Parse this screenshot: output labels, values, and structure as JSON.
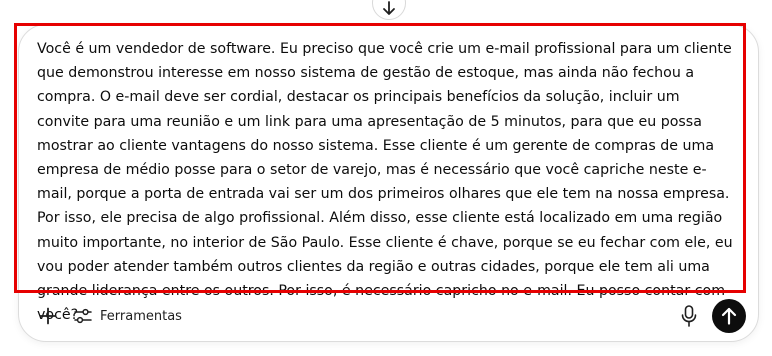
{
  "composer": {
    "prompt_text": "Você é um vendedor de software. Eu preciso que você crie um e-mail profissional para um cliente que demonstrou interesse em nosso sistema de gestão de estoque, mas ainda não fechou a compra. O e-mail deve ser cordial, destacar os principais benefícios da solução, incluir um convite para uma reunião e um link para uma apresentação de 5 minutos, para que eu possa mostrar ao cliente vantagens do nosso sistema. Esse cliente é um gerente de compras de uma empresa de médio posse para o setor de varejo, mas é necessário que você capriche neste e-mail, porque a porta de entrada vai ser um dos primeiros olhares que ele tem na nossa empresa. Por isso, ele precisa de algo profissional. Além disso, esse cliente está localizado em uma região muito importante, no interior de São Paulo. Esse cliente é chave, porque se eu fechar com ele, eu vou poder atender também outros clientes da região e outras cidades, porque ele tem ali uma grande liderança entre os outros. Por isso, é necessário capricho no e-mail. Eu posso contar com você?",
    "highlight_color": "#e60000"
  },
  "toolbar": {
    "add_icon": "plus-icon",
    "tools_icon": "sliders-icon",
    "tools_label": "Ferramentas",
    "mic_icon": "microphone-icon",
    "send_icon": "arrow-up-icon",
    "send_button_color": "#0d0d0d"
  },
  "scroll": {
    "icon": "arrow-down-icon"
  }
}
